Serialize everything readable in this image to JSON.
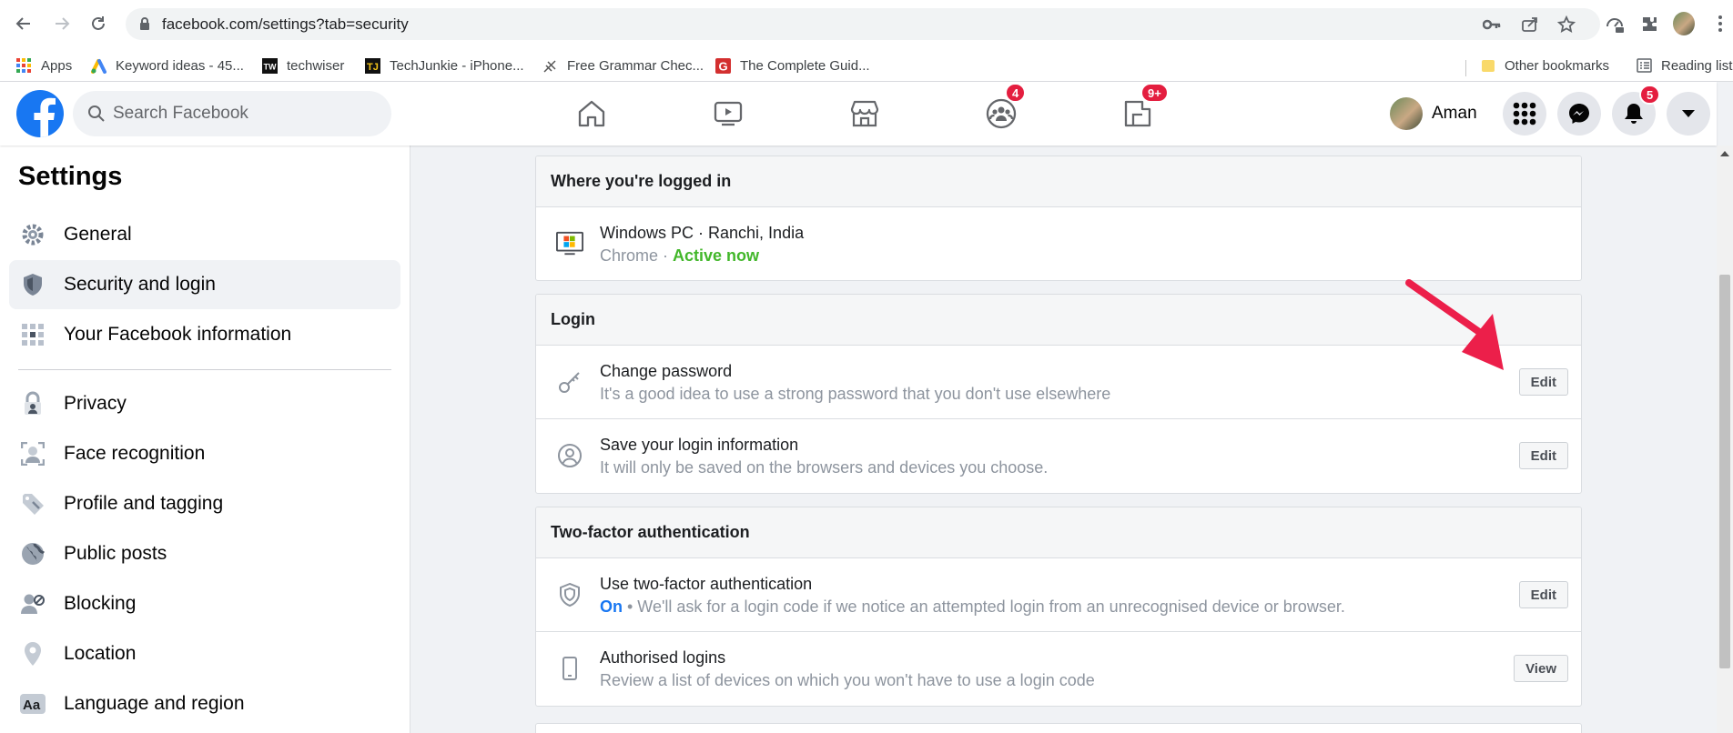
{
  "browser": {
    "url": "facebook.com/settings?tab=security",
    "bookmarks": [
      {
        "label": "Apps",
        "icon": "apps-grid-icon"
      },
      {
        "label": "Keyword ideas - 45...",
        "icon": "google-ads-icon"
      },
      {
        "label": "techwiser",
        "icon": "techwiser-icon"
      },
      {
        "label": "TechJunkie - iPhone...",
        "icon": "techjunkie-icon"
      },
      {
        "label": "Free Grammar Chec...",
        "icon": "feather-icon"
      },
      {
        "label": "The Complete Guid...",
        "icon": "g-logo-icon"
      }
    ],
    "other_bookmarks": "Other bookmarks",
    "reading_list": "Reading list"
  },
  "header": {
    "search_placeholder": "Search Facebook",
    "profile_name": "Aman",
    "badges": {
      "groups": "4",
      "gaming": "9+",
      "notifications": "5"
    }
  },
  "sidebar": {
    "title": "Settings",
    "items": [
      {
        "label": "General",
        "icon": "gear-icon"
      },
      {
        "label": "Security and login",
        "icon": "shield-icon",
        "active": true
      },
      {
        "label": "Your Facebook information",
        "icon": "grid-dots-icon"
      },
      {
        "label": "Privacy",
        "icon": "lock-icon"
      },
      {
        "label": "Face recognition",
        "icon": "face-scan-icon"
      },
      {
        "label": "Profile and tagging",
        "icon": "tag-icon"
      },
      {
        "label": "Public posts",
        "icon": "globe-icon"
      },
      {
        "label": "Blocking",
        "icon": "user-block-icon"
      },
      {
        "label": "Location",
        "icon": "location-pin-icon"
      },
      {
        "label": "Language and region",
        "icon": "language-aa-icon"
      }
    ]
  },
  "main": {
    "logged_in": {
      "header": "Where you're logged in",
      "device": "Windows PC · Ranchi, India",
      "browser": "Chrome · ",
      "status": "Active now"
    },
    "login": {
      "header": "Login",
      "change_password": {
        "title": "Change password",
        "subtitle": "It's a good idea to use a strong password that you don't use elsewhere",
        "button": "Edit"
      },
      "save_login": {
        "title": "Save your login information",
        "subtitle": "It will only be saved on the browsers and devices you choose.",
        "button": "Edit"
      }
    },
    "two_factor": {
      "header": "Two-factor authentication",
      "use_2fa": {
        "title": "Use two-factor authentication",
        "status": "On",
        "subtitle": " • We'll ask for a login code if we notice an attempted login from an unrecognised device or browser.",
        "button": "Edit"
      },
      "authorised": {
        "title": "Authorised logins",
        "subtitle": "Review a list of devices on which you won't have to use a login code",
        "button": "View"
      }
    }
  },
  "colors": {
    "facebook_blue": "#1877f2",
    "badge_red": "#e41e3f",
    "active_green": "#42b72a",
    "annotation_arrow": "#ec1f4a"
  }
}
